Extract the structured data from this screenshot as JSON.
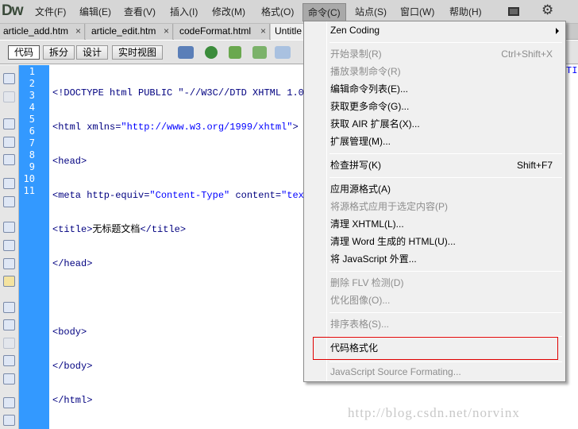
{
  "app": {
    "logo": "Dw"
  },
  "menubar": [
    {
      "label": "文件(F)"
    },
    {
      "label": "编辑(E)"
    },
    {
      "label": "查看(V)"
    },
    {
      "label": "插入(I)"
    },
    {
      "label": "修改(M)"
    },
    {
      "label": "格式(O)"
    },
    {
      "label": "命令(C)"
    },
    {
      "label": "站点(S)"
    },
    {
      "label": "窗口(W)"
    },
    {
      "label": "帮助(H)"
    }
  ],
  "tabs": [
    {
      "label": "article_add.htm"
    },
    {
      "label": "article_edit.htm"
    },
    {
      "label": "codeFormat.html"
    },
    {
      "label": "Untitle"
    }
  ],
  "close_glyph": "×",
  "views": [
    "代码",
    "拆分",
    "设计",
    "实时视图"
  ],
  "line_numbers": [
    "1",
    "2",
    "3",
    "4",
    "5",
    "6",
    "7",
    "8",
    "9",
    "10",
    "11"
  ],
  "code": {
    "l1": "<!DOCTYPE html PUBLIC \"-//W3C//DTD XHTML 1.0",
    "l1_tail": "TI",
    "l2a": "<html xmlns=",
    "l2b": "\"http://www.w3.org/1999/xhtml\"",
    "l2c": ">",
    "l3": "<head>",
    "l4a": "<meta http-equiv=",
    "l4b": "\"Content-Type\"",
    "l4c": " content=",
    "l4d": "\"text",
    "l5a": "<title>",
    "l5b": "无标题文档",
    "l5c": "</title>",
    "l6": "</head>",
    "l8": "<body>",
    "l9": "</body>",
    "l10": "</html>"
  },
  "command_menu": {
    "items": [
      {
        "label": "Zen Coding"
      },
      {
        "label": "开始录制(R)",
        "shortcut": "Ctrl+Shift+X"
      },
      {
        "label": "播放录制命令(R)"
      },
      {
        "label": "编辑命令列表(E)..."
      },
      {
        "label": "获取更多命令(G)..."
      },
      {
        "label": "获取 AIR 扩展名(X)..."
      },
      {
        "label": "扩展管理(M)..."
      },
      {
        "label": "检查拼写(K)",
        "shortcut": "Shift+F7"
      },
      {
        "label": "应用源格式(A)"
      },
      {
        "label": "将源格式应用于选定内容(P)"
      },
      {
        "label": "清理 XHTML(L)..."
      },
      {
        "label": "清理 Word 生成的 HTML(U)..."
      },
      {
        "label": "将 JavaScript 外置..."
      },
      {
        "label": "删除 FLV 检测(D)"
      },
      {
        "label": "优化图像(O)..."
      },
      {
        "label": "排序表格(S)..."
      },
      {
        "label": "代码格式化"
      },
      {
        "label": "JavaScript Source Formating..."
      }
    ]
  },
  "watermark": "http://blog.csdn.net/norvinx",
  "colors": {
    "gutter": "#3399ff",
    "highlight": "#e00000"
  }
}
